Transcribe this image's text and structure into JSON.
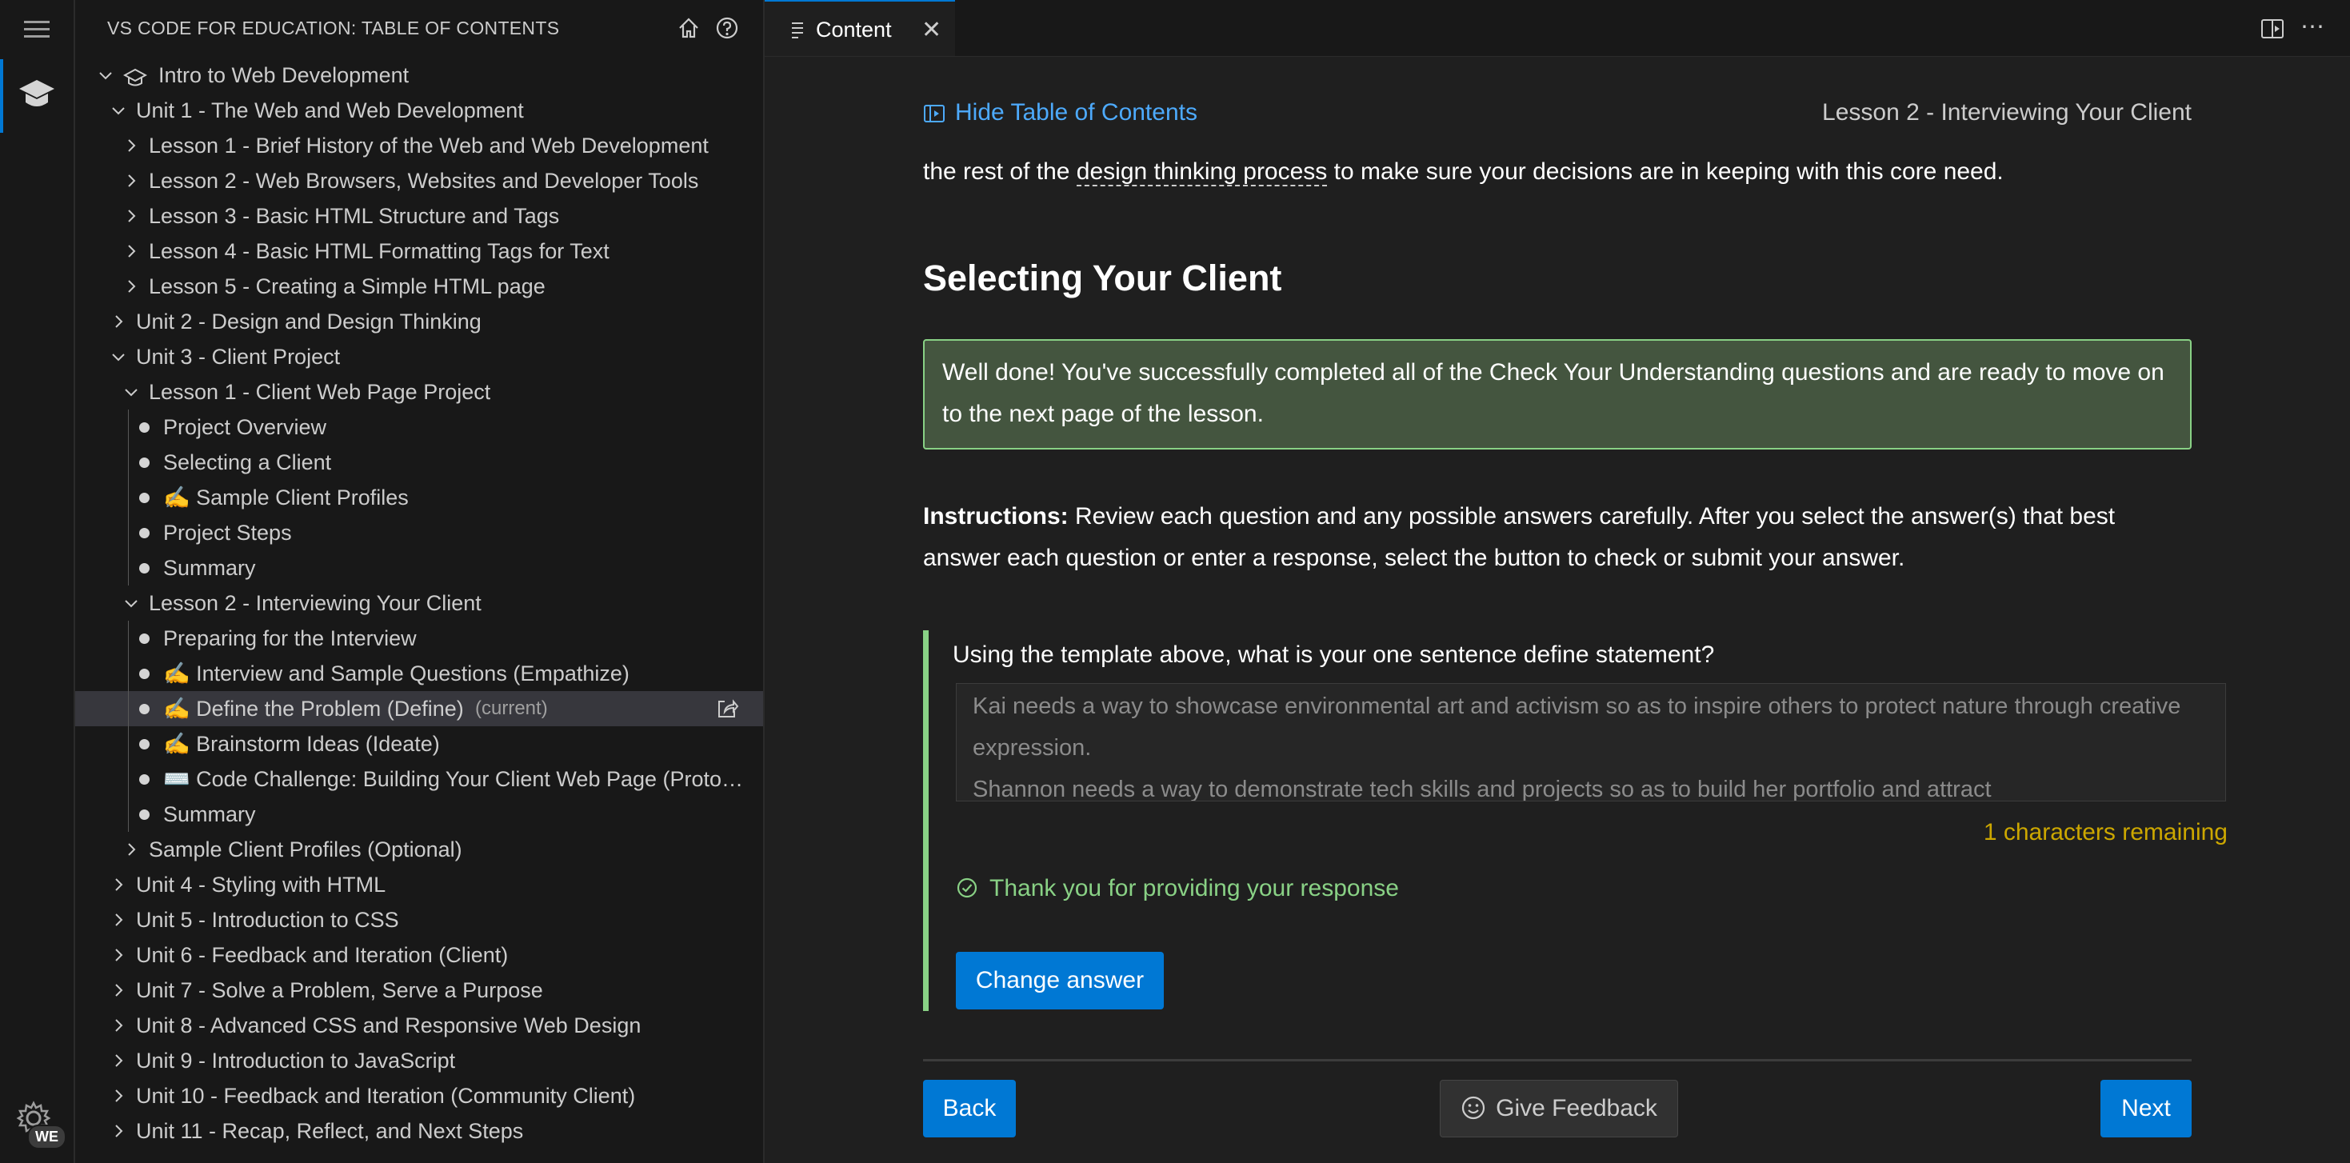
{
  "sidebar": {
    "title": "VS CODE FOR EDUCATION: TABLE OF CONTENTS",
    "tree": [
      {
        "label": "Intro to Web Development",
        "type": "course",
        "expanded": true
      },
      {
        "label": "Unit 1 - The Web and Web Development",
        "type": "unit",
        "expanded": true
      },
      {
        "label": "Lesson 1 - Brief History of the Web and Web Development",
        "type": "lesson",
        "expanded": false
      },
      {
        "label": "Lesson 2 - Web Browsers, Websites and Developer Tools",
        "type": "lesson",
        "expanded": false
      },
      {
        "label": "Lesson 3 - Basic HTML Structure and Tags",
        "type": "lesson",
        "expanded": false
      },
      {
        "label": "Lesson 4 - Basic HTML Formatting Tags for Text",
        "type": "lesson",
        "expanded": false
      },
      {
        "label": "Lesson 5 - Creating a Simple HTML page",
        "type": "lesson",
        "expanded": false
      },
      {
        "label": "Unit 2 - Design and Design Thinking",
        "type": "unit",
        "expanded": false
      },
      {
        "label": "Unit 3 - Client Project",
        "type": "unit",
        "expanded": true
      },
      {
        "label": "Lesson 1 - Client Web Page Project",
        "type": "lesson",
        "expanded": true
      },
      {
        "label": "Project Overview",
        "type": "page"
      },
      {
        "label": "Selecting a Client",
        "type": "page"
      },
      {
        "label": "✍️ Sample Client Profiles",
        "type": "page"
      },
      {
        "label": "Project Steps",
        "type": "page"
      },
      {
        "label": "Summary",
        "type": "page"
      },
      {
        "label": "Lesson 2 - Interviewing Your Client",
        "type": "lesson",
        "expanded": true
      },
      {
        "label": "Preparing for the Interview",
        "type": "page"
      },
      {
        "label": "✍️ Interview and Sample Questions (Empathize)",
        "type": "page"
      },
      {
        "label": "✍️ Define the Problem (Define)",
        "type": "page",
        "current": "(current)"
      },
      {
        "label": "✍️ Brainstorm Ideas (Ideate)",
        "type": "page"
      },
      {
        "label": "⌨️ Code Challenge: Building Your Client Web Page (Prototype)",
        "type": "page"
      },
      {
        "label": "Summary",
        "type": "page"
      },
      {
        "label": "Sample Client Profiles (Optional)",
        "type": "lesson",
        "expanded": false
      },
      {
        "label": "Unit 4 - Styling with HTML",
        "type": "unit",
        "expanded": false
      },
      {
        "label": "Unit 5 - Introduction to CSS",
        "type": "unit",
        "expanded": false
      },
      {
        "label": "Unit 6 - Feedback and Iteration (Client)",
        "type": "unit",
        "expanded": false
      },
      {
        "label": "Unit 7 - Solve a Problem, Serve a Purpose",
        "type": "unit",
        "expanded": false
      },
      {
        "label": "Unit 8 - Advanced CSS and Responsive Web Design",
        "type": "unit",
        "expanded": false
      },
      {
        "label": "Unit 9 - Introduction to JavaScript",
        "type": "unit",
        "expanded": false
      },
      {
        "label": "Unit 10 - Feedback and Iteration (Community Client)",
        "type": "unit",
        "expanded": false
      },
      {
        "label": "Unit 11 - Recap, Reflect, and Next Steps",
        "type": "unit",
        "expanded": false
      }
    ]
  },
  "activity_bar": {
    "badge": "WE",
    "icons": [
      "menu-icon",
      "education-icon",
      "settings-gear-icon"
    ]
  },
  "editor": {
    "tab_label": "Content",
    "tab_close": "✕",
    "more_actions": "⋯"
  },
  "content": {
    "hide_toc": "Hide Table of Contents",
    "lesson_title": "Lesson 2 - Interviewing Your Client",
    "intro_before": "the rest of the ",
    "intro_link": "design thinking process",
    "intro_after": " to make sure your decisions are in keeping with this core need.",
    "heading": "Selecting Your Client",
    "success_message": "Well done! You've successfully completed all of the Check Your Understanding questions and are ready to move on to the next page of the lesson.",
    "instructions_label": "Instructions:",
    "instructions_text": " Review each question and any possible answers carefully. After you select the answer(s) that best answer each question or enter a response, select the button to check or submit your answer.",
    "question": "Using the template above, what is your one sentence define statement?",
    "answer": "Kai needs a way to showcase environmental art and activism so as to inspire others to protect nature through creative expression.\nShannon needs a way to demonstrate tech skills and projects so as to build her portfolio and attract",
    "chars_remaining": "1 characters remaining",
    "thanks": "Thank you for providing your response",
    "change_answer": "Change answer",
    "back": "Back",
    "give_feedback": "Give Feedback",
    "next": "Next"
  },
  "colors": {
    "accent": "#0078d4",
    "link": "#4daafc",
    "success_border": "#89d185",
    "success_bg": "#44553f",
    "warning": "#cca700"
  }
}
